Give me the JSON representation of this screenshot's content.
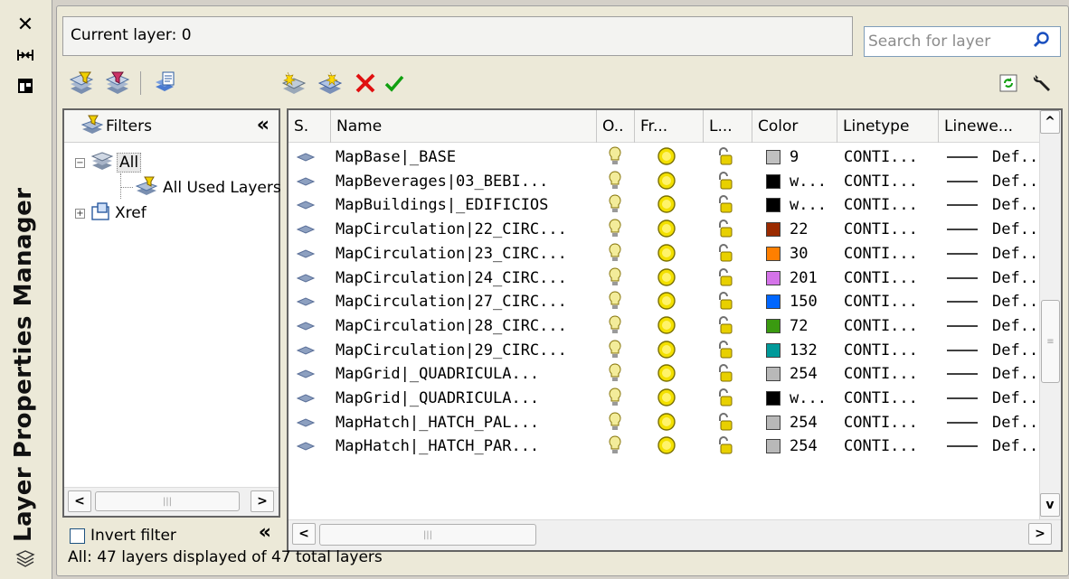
{
  "palette_title": "Layer Properties Manager",
  "strip_icons": [
    "close-icon",
    "auto-hide-icon",
    "properties-icon",
    "layer-stack-icon"
  ],
  "current_layer": "Current layer: 0",
  "search": {
    "placeholder": "Search for layer"
  },
  "toolbar_left": [
    "new-property-filter-icon",
    "new-group-filter-icon",
    "layer-states-manager-icon"
  ],
  "toolbar_mid": [
    "new-layer-icon",
    "new-layer-vp-frozen-icon",
    "delete-layer-icon",
    "set-current-icon"
  ],
  "toolbar_right": [
    "refresh-icon",
    "settings-icon"
  ],
  "filters": {
    "header": "Filters",
    "tree": [
      {
        "label": "All",
        "expander": "−"
      },
      {
        "label": "All Used Layers",
        "expander": ""
      },
      {
        "label": "Xref",
        "expander": "+"
      }
    ],
    "invert_filter": "Invert filter"
  },
  "columns": [
    "S.",
    "Name",
    "O..",
    "Fr...",
    "L...",
    "Color",
    "Linetype",
    "Linewe..."
  ],
  "colors": {
    "bulb": "#f3ec9a",
    "sun": "#f3e000",
    "lock": "#e8d000"
  },
  "layers": [
    {
      "name": "MapBase|_BASE",
      "color_name": "9",
      "color_hex": "#c0c0c0",
      "linetype": "CONTI...",
      "lineweight": "Def.."
    },
    {
      "name": "MapBeverages|03_BEBI...",
      "color_name": "w...",
      "color_hex": "#000000",
      "linetype": "CONTI...",
      "lineweight": "Def.."
    },
    {
      "name": "MapBuildings|_EDIFICIOS",
      "color_name": "w...",
      "color_hex": "#000000",
      "linetype": "CONTI...",
      "lineweight": "Def.."
    },
    {
      "name": "MapCirculation|22_CIRC...",
      "color_name": "22",
      "color_hex": "#9a2a00",
      "linetype": "CONTI...",
      "lineweight": "Def.."
    },
    {
      "name": "MapCirculation|23_CIRC...",
      "color_name": "30",
      "color_hex": "#ff7f00",
      "linetype": "CONTI...",
      "lineweight": "Def.."
    },
    {
      "name": "MapCirculation|24_CIRC...",
      "color_name": "201",
      "color_hex": "#d473e8",
      "linetype": "CONTI...",
      "lineweight": "Def.."
    },
    {
      "name": "MapCirculation|27_CIRC...",
      "color_name": "150",
      "color_hex": "#0066ff",
      "linetype": "CONTI...",
      "lineweight": "Def.."
    },
    {
      "name": "MapCirculation|28_CIRC...",
      "color_name": "72",
      "color_hex": "#3a9a10",
      "linetype": "CONTI...",
      "lineweight": "Def.."
    },
    {
      "name": "MapCirculation|29_CIRC...",
      "color_name": "132",
      "color_hex": "#009999",
      "linetype": "CONTI...",
      "lineweight": "Def.."
    },
    {
      "name": "MapGrid|_QUADRICULA...",
      "color_name": "254",
      "color_hex": "#b8b8b8",
      "linetype": "CONTI...",
      "lineweight": "Def.."
    },
    {
      "name": "MapGrid|_QUADRICULA...",
      "color_name": "w...",
      "color_hex": "#000000",
      "linetype": "CONTI...",
      "lineweight": "Def.."
    },
    {
      "name": "MapHatch|_HATCH_PAL...",
      "color_name": "254",
      "color_hex": "#b8b8b8",
      "linetype": "CONTI...",
      "lineweight": "Def.."
    },
    {
      "name": "MapHatch|_HATCH_PAR...",
      "color_name": "254",
      "color_hex": "#b8b8b8",
      "linetype": "CONTI...",
      "lineweight": "Def.."
    }
  ],
  "status": "All: 47 layers displayed of 47 total layers"
}
